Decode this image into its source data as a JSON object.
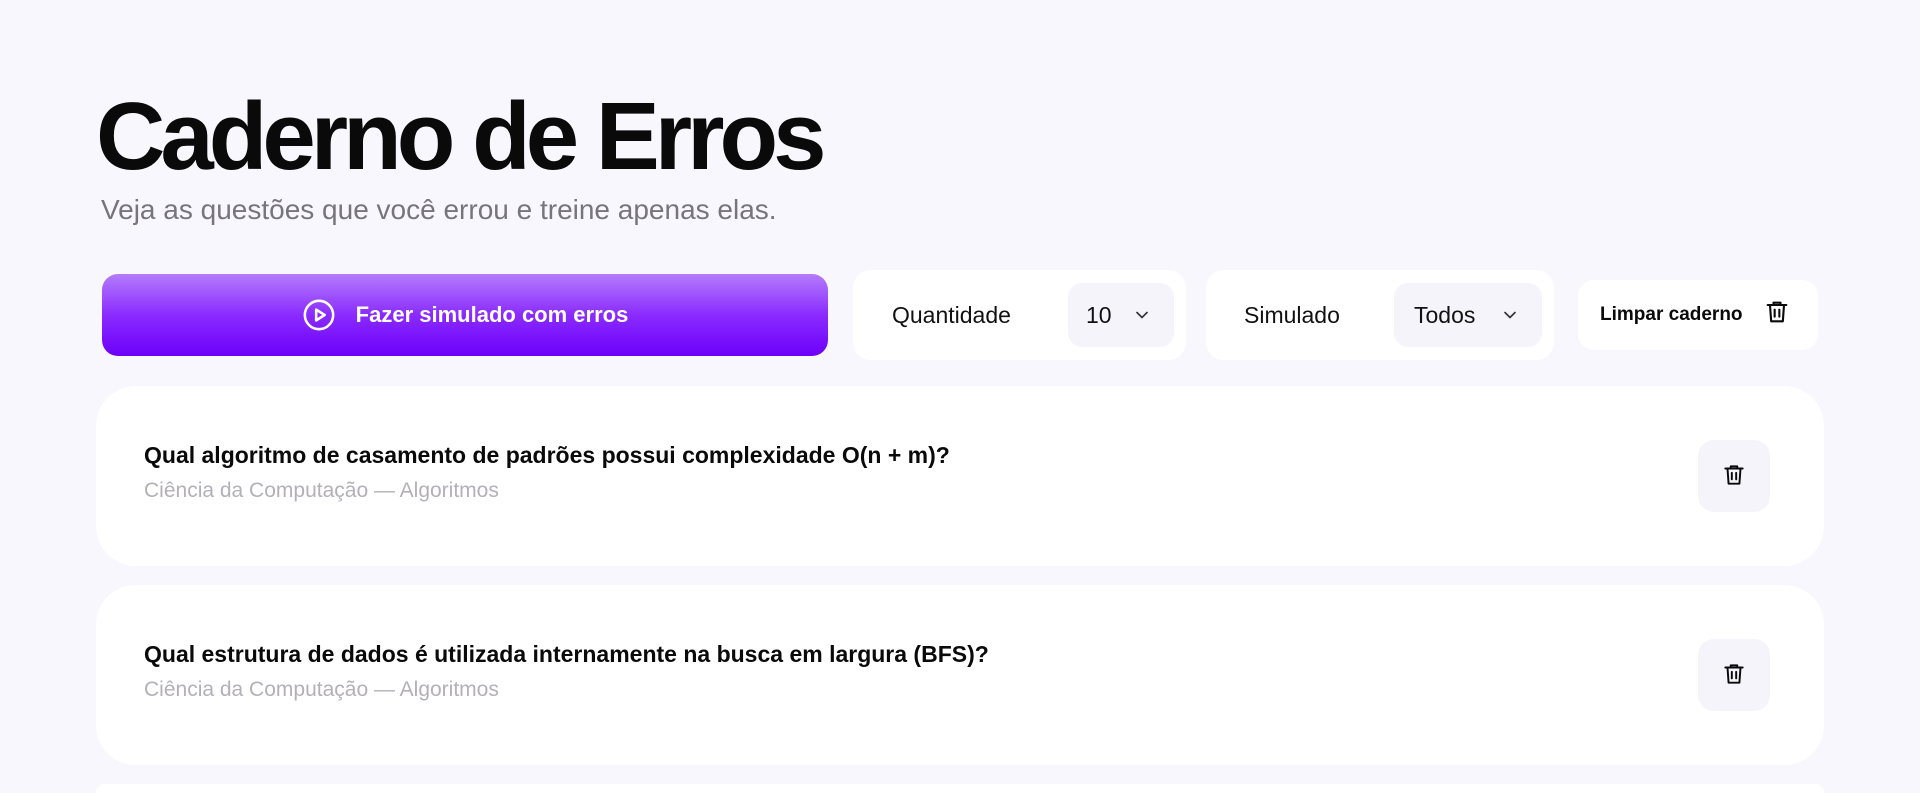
{
  "header": {
    "title": "Caderno de Erros",
    "subtitle": "Veja as questões que você errou e treine apenas elas."
  },
  "toolbar": {
    "simulate_button": {
      "label": "Fazer simulado com erros",
      "icon": "play-circle-icon"
    },
    "quantity_filter": {
      "label": "Quantidade",
      "value": "10",
      "icon": "chevron-down-icon"
    },
    "exam_filter": {
      "label": "Simulado",
      "value": "Todos",
      "icon": "chevron-down-icon"
    },
    "clear_button": {
      "label": "Limpar caderno",
      "icon": "trash-icon"
    }
  },
  "questions": [
    {
      "question": "Qual algoritmo de casamento de padrões possui complexidade O(n + m)?",
      "meta": "Ciência da Computação — Algoritmos",
      "delete_icon": "trash-icon"
    },
    {
      "question": "Qual estrutura de dados é utilizada internamente na busca em largura (BFS)?",
      "meta": "Ciência da Computação — Algoritmos",
      "delete_icon": "trash-icon"
    }
  ],
  "colors": {
    "background": "#f9f7fe",
    "accent_top": "#b47cfa",
    "accent_bottom": "#6d00fa",
    "card": "#ffffff",
    "muted_text": "#b3b0b8",
    "subtitle_text": "#77747c"
  }
}
